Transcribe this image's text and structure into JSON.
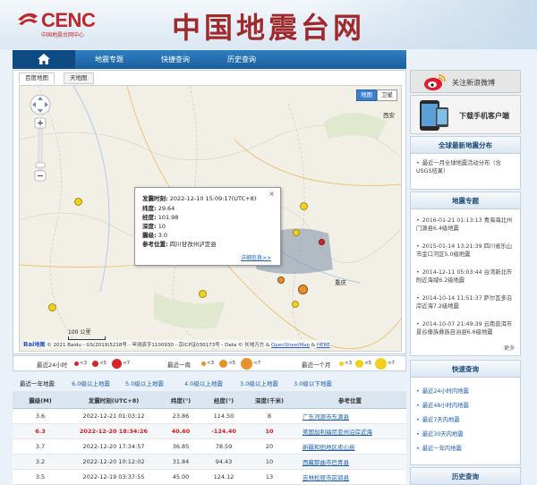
{
  "header": {
    "logo_text": "CENC",
    "logo_sub": "中国地震台网中心",
    "site_title": "中国地震台网"
  },
  "nav": {
    "home_icon": "home-icon",
    "items": [
      "地震专题",
      "快捷查询",
      "历史查询"
    ]
  },
  "map": {
    "tabs": [
      "百度地图",
      "天地图"
    ],
    "type_buttons": [
      "地图",
      "卫星"
    ],
    "scale": "100 公里",
    "copyright_brand": "Bai",
    "copyright_brand2": "地图",
    "copyright_text": "© 2021 Baidu - GS(2019)5218号 - 甲测资字1100930 - 京ICP证030173号 - Data © 长地万方 &",
    "osm_link": "OpenStreetMap",
    "here_link": "HERE",
    "labels": {
      "xian": "西安",
      "chongqing": "重庆"
    },
    "popup": {
      "time_label": "发震时刻:",
      "time": "2022-12-10 15:09:17(UTC+8)",
      "lat_label": "纬度:",
      "lat": "29.64",
      "lon_label": "经度:",
      "lon": "101.98",
      "depth_label": "深度:",
      "depth": "10",
      "mag_label": "震级:",
      "mag": "3.0",
      "loc_label": "参考位置:",
      "loc": "四川甘孜州泸定县",
      "more": "详细信息>>"
    },
    "colors": {
      "day": "#d7262a",
      "week": "#e8902a",
      "month": "#f0d21e"
    }
  },
  "legend": {
    "groups": [
      {
        "label": "最近24小时",
        "items": [
          "<3",
          "<5",
          "<7"
        ]
      },
      {
        "label": "最近一周",
        "items": [
          "<3",
          "<5",
          "<7"
        ]
      },
      {
        "label": "最近一个月",
        "items": [
          "<3",
          "<5",
          "<7"
        ]
      }
    ]
  },
  "filters": [
    "最近一年地震",
    "6.0级以上地震",
    "5.0级以上地震",
    "4.0级以上地震",
    "3.0级以上地震",
    "3.0级以下地震"
  ],
  "table": {
    "headers": [
      "震级(M)",
      "发震时刻(UTC+8)",
      "纬度(°)",
      "经度(°)",
      "深度(千米)",
      "参考位置"
    ],
    "rows": [
      [
        "3.6",
        "2022-12-21 01:03:12",
        "23.86",
        "114.50",
        "8",
        "广东河源市东源县"
      ],
      [
        "6.3",
        "2022-12-20 18:34:26",
        "40.60",
        "-124.40",
        "10",
        "美国加利福尼亚州沿岸近海"
      ],
      [
        "3.7",
        "2022-12-20 17:34:57",
        "36.85",
        "78.59",
        "20",
        "新疆和田地区皮山县"
      ],
      [
        "3.2",
        "2022-12-20 10:12:02",
        "31.84",
        "94.43",
        "10",
        "西藏那曲市巴青县"
      ],
      [
        "3.5",
        "2022-12-19 03:37:55",
        "45.00",
        "124.12",
        "13",
        "吉林松原市前郭县"
      ]
    ]
  },
  "sidebar": {
    "weibo": "关注新浪微博",
    "app": "下载手机客户端",
    "global_head": "全球最新地震分布",
    "global_items": [
      "最近一月全球地震活动分布（含USGS结果）"
    ],
    "topic_head": "地震专题",
    "topics": [
      "2016-01-21 01:13:13 青海海北州门源县6.4级地震",
      "2015-01-14 13:21:39 四川省乐山市金口河区5.0级地震",
      "2014-12-11 05:03:44 台湾新北市附近海域6.2级地震",
      "2014-10-14 11:51:37 萨尔瓦多沿岸近海7.2级地震",
      "2014-10-07 21:49:39 云南普洱市景谷傣族彝族自治县6.6级地震"
    ],
    "more": "更多",
    "quick_head": "快速查询",
    "quick_items": [
      "最近24小时内地震",
      "最近48小时内地震",
      "最近7天内地震",
      "最近30天内地震",
      "最近一年内地震"
    ],
    "history_head": "历史查询"
  }
}
